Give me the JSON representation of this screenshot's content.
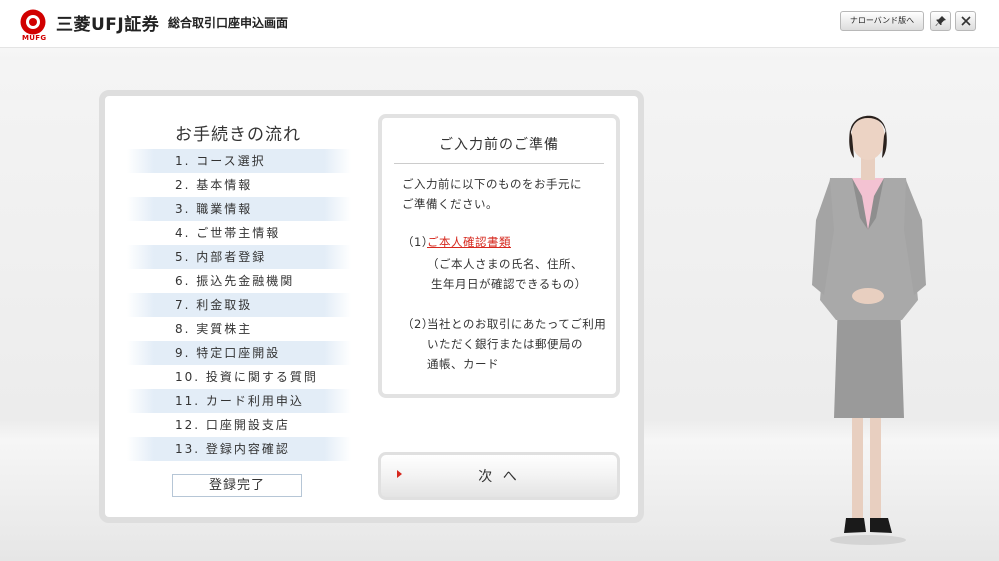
{
  "header": {
    "brand_name": "三菱UFJ証券",
    "logo_text": "MUFG",
    "screen_title": "総合取引口座申込画面",
    "narrowband_button": "ナローバンド版へ",
    "pin_icon": "pin-icon",
    "close_icon": "close-icon"
  },
  "steps": {
    "title": "お手続きの流れ",
    "items": [
      "1. コース選択",
      "2. 基本情報",
      "3. 職業情報",
      "4. ご世帯主情報",
      "5. 内部者登録",
      "6. 振込先金融機関",
      "7. 利金取扱",
      "8. 実質株主",
      "9. 特定口座開設",
      "10. 投資に関する質問",
      "11. カード利用申込",
      "12. 口座開設支店",
      "13. 登録内容確認"
    ],
    "done_label": "登録完了"
  },
  "prep": {
    "title": "ご入力前のご準備",
    "intro_line1": "ご入力前に以下のものをお手元に",
    "intro_line2": "ご準備ください。",
    "item1_label": "（1）",
    "item1_link": "ご本人確認書類",
    "item1_note_line1": "（ご本人さまの氏名、住所、",
    "item1_note_line2": "生年月日が確認できるもの）",
    "item2_label": "（2）",
    "item2_line1": "当社とのお取引にあたってご利用",
    "item2_line2": "いただく銀行または郵便局の",
    "item2_line3": "通帳、カード"
  },
  "next_button": "次 へ",
  "colors": {
    "brand_red": "#d10000",
    "link_red": "#d6281e",
    "step_highlight": "#e3edf7"
  }
}
